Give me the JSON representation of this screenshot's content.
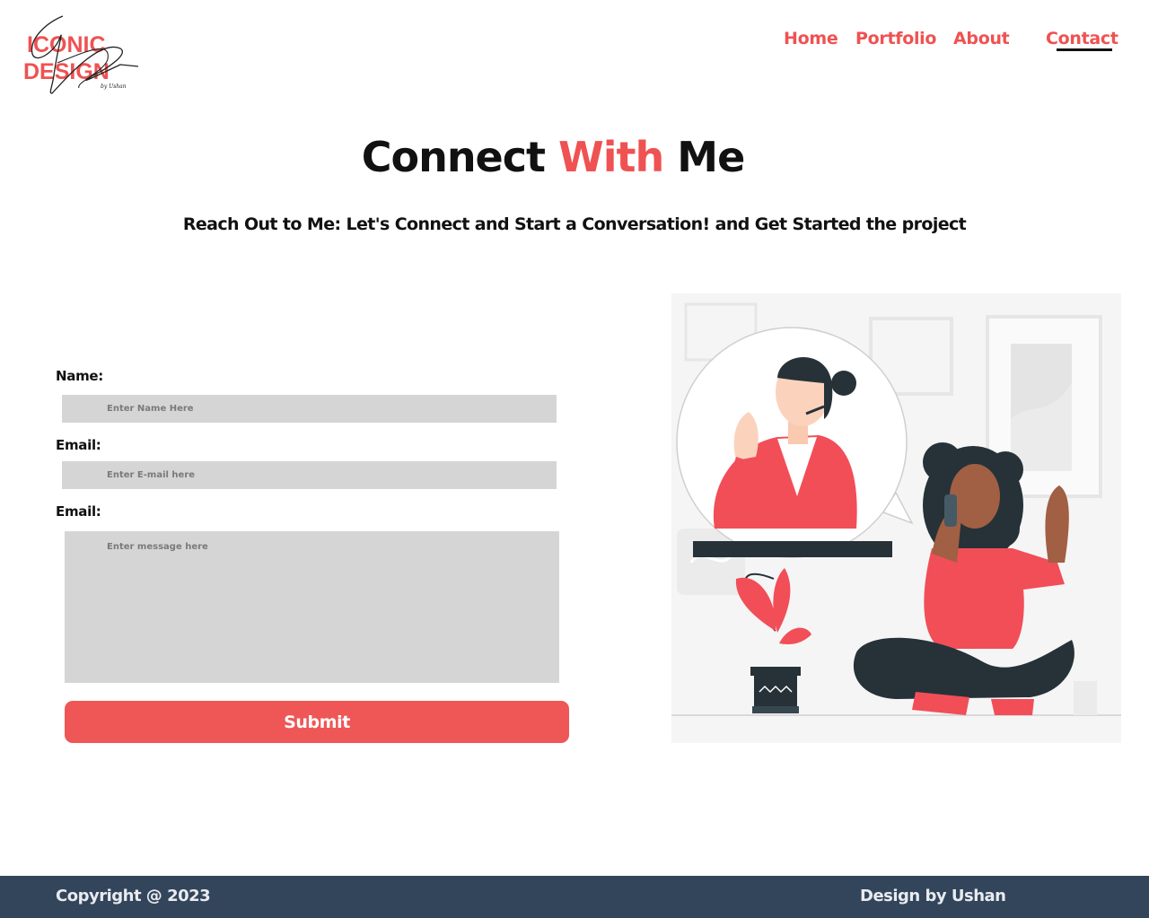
{
  "brand": {
    "logo_line1": "ICONIC",
    "logo_line2": "DESIGN",
    "logo_signature": "by Ushan",
    "accent_color": "#ef5252"
  },
  "nav": {
    "items": [
      {
        "label": "Home"
      },
      {
        "label": "Portfolio"
      },
      {
        "label": "About"
      },
      {
        "label": "Contact",
        "active": true
      }
    ]
  },
  "hero": {
    "title_part1": "Connect",
    "title_accent": "With",
    "title_part2": "Me",
    "subtitle": "Reach Out to Me: Let's Connect and Start a Conversation! and Get Started the project"
  },
  "form": {
    "name_label": "Name:",
    "name_placeholder": "Enter Name Here",
    "email_label": "Email:",
    "email_placeholder": "Enter E-mail here",
    "message_label": "Email:",
    "message_placeholder": "Enter message here",
    "submit_label": "Submit",
    "field_color": "#d5d5d5",
    "button_color": "#ef5656"
  },
  "illustration": {
    "icon": "contact-call-illustration"
  },
  "footer": {
    "copyright": "Copyright @ 2023",
    "credit": "Design by Ushan",
    "background": "#33455b"
  }
}
